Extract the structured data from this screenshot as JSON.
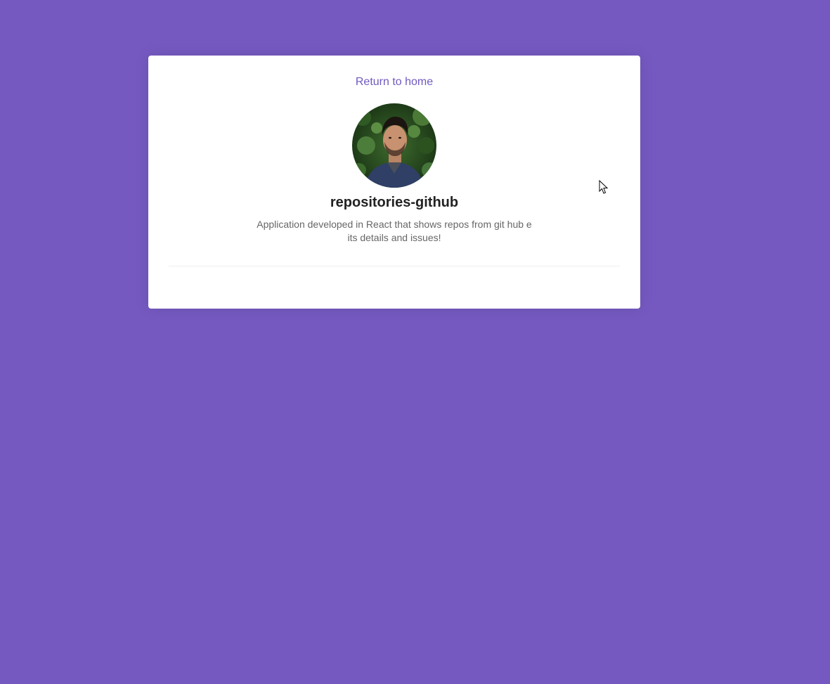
{
  "page": {
    "background_color": "#7559c1",
    "accent_color": "#7159c1"
  },
  "nav": {
    "home_link_label": "Return to home"
  },
  "repository": {
    "owner_avatar_alt": "repositories-github",
    "name": "repositories-github",
    "description": "Application developed in React that shows repos from git hub e its details and issues!"
  }
}
